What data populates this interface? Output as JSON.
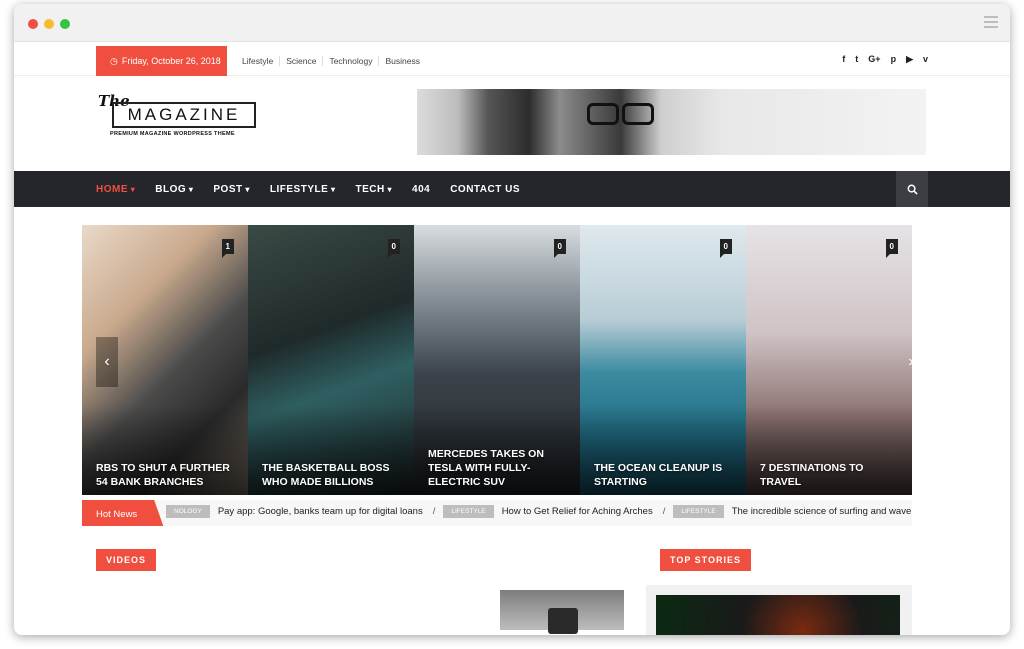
{
  "topbar": {
    "date": "Friday, October 26, 2018",
    "links": [
      "Lifestyle",
      "Science",
      "Technology",
      "Business"
    ],
    "socials": [
      {
        "name": "facebook-icon",
        "glyph": "f"
      },
      {
        "name": "twitter-icon",
        "glyph": "t"
      },
      {
        "name": "google-plus-icon",
        "glyph": "G+"
      },
      {
        "name": "pinterest-icon",
        "glyph": "p"
      },
      {
        "name": "youtube-icon",
        "glyph": "▶"
      },
      {
        "name": "vimeo-icon",
        "glyph": "v"
      }
    ]
  },
  "logo": {
    "the": "The",
    "name": "MAGAZINE",
    "tagline": "PREMIUM MAGAZINE WORDPRESS THEME"
  },
  "nav": {
    "items": [
      {
        "label": "HOME",
        "dropdown": true,
        "active": true
      },
      {
        "label": "BLOG",
        "dropdown": true
      },
      {
        "label": "POST",
        "dropdown": true
      },
      {
        "label": "LIFESTYLE",
        "dropdown": true
      },
      {
        "label": "TECH",
        "dropdown": true
      },
      {
        "label": "404",
        "dropdown": false
      },
      {
        "label": "CONTACT US",
        "dropdown": false
      }
    ]
  },
  "slides": [
    {
      "count": "1",
      "title": "RBS TO SHUT A FURTHER 54 BANK BRANCHES",
      "bg": "linear-gradient(135deg,#e9d9c8 0%,#c9a98d 30%,#4a4a4a 55%,#2a2a2a 75%,#7d7064 100%)"
    },
    {
      "count": "0",
      "title": "THE BASKETBALL BOSS WHO MADE BILLIONS",
      "bg": "linear-gradient(160deg,#3a4a45 0%,#1f2a2a 40%,#2f5f62 60%,#1c2222 100%)"
    },
    {
      "count": "0",
      "title": "MERCEDES TAKES ON TESLA WITH FULLY-ELECTRIC SUV",
      "bg": "linear-gradient(180deg,#d8dde0 0%,#8c959c 25%,#3c444b 55%,#1d2226 100%)"
    },
    {
      "count": "0",
      "title": "THE OCEAN CLEANUP IS STARTING",
      "bg": "linear-gradient(180deg,#dfe9ee 0%,#b8cdd6 35%,#3a8aa0 55%,#1f6b82 80%,#164f62 100%)"
    },
    {
      "count": "0",
      "title": "7 DESTINATIONS TO TRAVEL",
      "bg": "linear-gradient(180deg,#e6e3e6 0%,#cfc3c5 40%,#8d7472 70%,#4d3e3d 100%)"
    }
  ],
  "ticker": {
    "label": "Hot News",
    "items": [
      {
        "cat": "NOLOGY",
        "text": "Pay app: Google, banks team up for digital loans"
      },
      {
        "cat": "LIFESTYLE",
        "text": "How to Get Relief for Aching Arches"
      },
      {
        "cat": "LIFESTYLE",
        "text": "The incredible science of surfing and wave riding"
      }
    ]
  },
  "sections": {
    "videos": "VIDEOS",
    "top_stories": "TOP STORIES"
  },
  "colors": {
    "accent": "#f04e3e",
    "nav_bg": "#25262b"
  }
}
